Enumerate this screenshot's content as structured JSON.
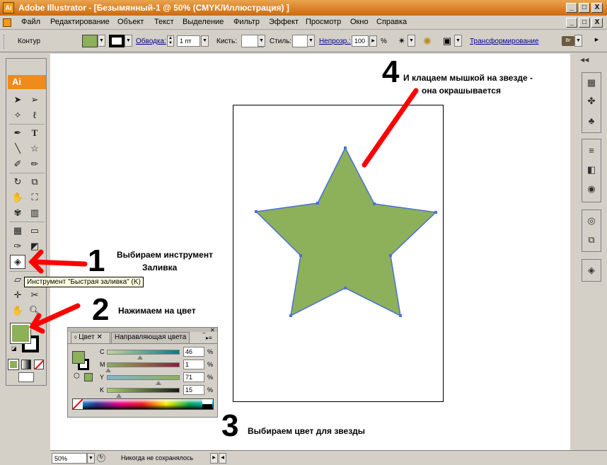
{
  "window": {
    "title": "Adobe Illustrator - [Безымянный-1 @ 50% (CMYK/Иллюстрация) ]",
    "minimize": "_",
    "restore": "□",
    "close": "X"
  },
  "menu": [
    "Файл",
    "Редактирование",
    "Объект",
    "Текст",
    "Выделение",
    "Фильтр",
    "Эффект",
    "Просмотр",
    "Окно",
    "Справка"
  ],
  "control": {
    "contour_label": "Контур",
    "stroke_link": "Обводка:",
    "stroke_value": "1 пт",
    "brush_label": "Кисть:",
    "style_label": "Стиль:",
    "opacity_link": "Непрозр.:",
    "opacity_value": "100",
    "opacity_unit": "%",
    "transform_link": "Трансформирование",
    "fill_color": "#8db05a"
  },
  "toolbox": {
    "logo": "Ai",
    "selected_tool": "live-paint-bucket"
  },
  "tooltip": "Инструмент \"Быстрая заливка\" (K)",
  "color_panel": {
    "tab_color": "Цвет",
    "tab_guide": "Направляющая цвета",
    "sliders": [
      {
        "label": "C",
        "value": "46",
        "unit": "%"
      },
      {
        "label": "M",
        "value": "1",
        "unit": "%"
      },
      {
        "label": "Y",
        "value": "71",
        "unit": "%"
      },
      {
        "label": "K",
        "value": "15",
        "unit": "%"
      }
    ]
  },
  "annotations": {
    "step1_num": "1",
    "step1_line1": "Выбираем инструмент",
    "step1_line2": "Заливка",
    "step2_num": "2",
    "step2_text": "Нажимаем на цвет",
    "step3_num": "3",
    "step3_text": "Выбираем цвет для звезды",
    "step4_num": "4",
    "step4_line1": "И клацаем мышкой на звезде -",
    "step4_line2": "она окрашывается"
  },
  "status": {
    "zoom": "50%",
    "save_state": "Никогда не сохранялось"
  },
  "colors": {
    "star_fill": "#8db05a",
    "star_stroke": "#4a70d8",
    "arrow": "#ff0000"
  }
}
